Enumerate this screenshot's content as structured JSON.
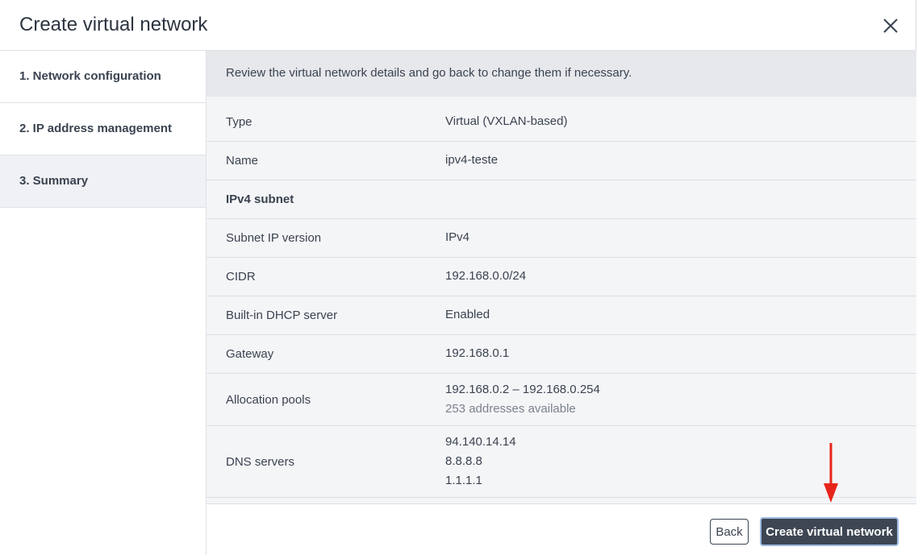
{
  "dialog": {
    "title": "Create virtual network"
  },
  "steps": [
    {
      "label": "1. Network configuration"
    },
    {
      "label": "2. IP address management"
    },
    {
      "label": "3. Summary"
    }
  ],
  "info": "Review the virtual network details and go back to change them if necessary.",
  "summary": {
    "type": {
      "label": "Type",
      "value": "Virtual (VXLAN-based)"
    },
    "name": {
      "label": "Name",
      "value": "ipv4-teste"
    },
    "section": {
      "label": "IPv4 subnet"
    },
    "ip_version": {
      "label": "Subnet IP version",
      "value": "IPv4"
    },
    "cidr": {
      "label": "CIDR",
      "value": "192.168.0.0/24"
    },
    "dhcp": {
      "label": "Built-in DHCP server",
      "value": "Enabled"
    },
    "gateway": {
      "label": "Gateway",
      "value": "192.168.0.1"
    },
    "pools": {
      "label": "Allocation pools",
      "value": "192.168.0.2 – 192.168.0.254",
      "note": "253 addresses available"
    },
    "dns": {
      "label": "DNS servers",
      "values": [
        "94.140.14.14",
        "8.8.8.8",
        "1.1.1.1"
      ]
    }
  },
  "footer": {
    "back_label": "Back",
    "create_label": "Create virtual network"
  },
  "colors": {
    "primary_button": "#3d4652",
    "annotation_arrow": "#e8251b"
  },
  "icons": {
    "close": "close-icon",
    "annotation": "red-arrow-icon"
  }
}
